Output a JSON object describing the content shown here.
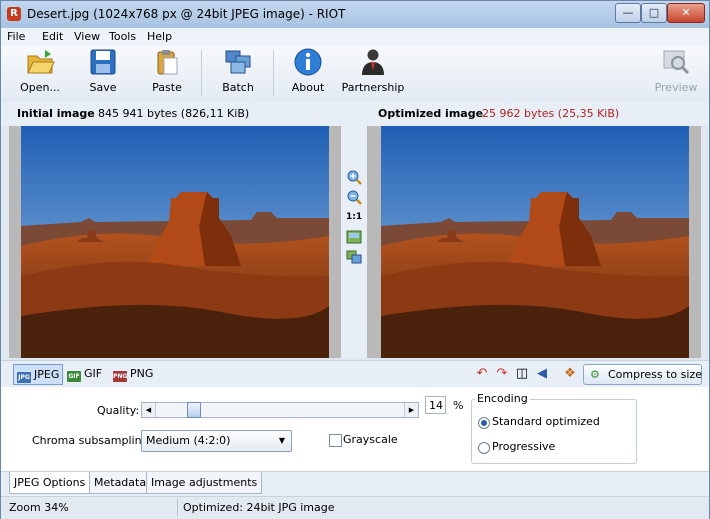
{
  "window": {
    "title": "Desert.jpg (1024x768 px @ 24bit JPEG image) - RIOT"
  },
  "menu": [
    "File",
    "Edit",
    "View",
    "Tools",
    "Help"
  ],
  "toolbar": {
    "open": "Open...",
    "save": "Save",
    "paste": "Paste",
    "batch": "Batch",
    "about": "About",
    "partnership": "Partnership",
    "preview": "Preview"
  },
  "images": {
    "initial_label": "Initial image",
    "initial_size": "845 941 bytes (826,11 KiB)",
    "optimized_label": "Optimized image",
    "optimized_size": "25 962 bytes (25,35 KiB)"
  },
  "zoom_tools": {
    "one_to_one": "1:1"
  },
  "format_tabs": [
    "JPEG",
    "GIF",
    "PNG"
  ],
  "actions": {
    "compress": "Compress to size"
  },
  "options": {
    "quality_label": "Quality:",
    "quality_value": "14",
    "quality_unit": "%",
    "chroma_label": "Chroma subsampling:",
    "chroma_value": "Medium (4:2:0)",
    "grayscale_label": "Grayscale",
    "encoding_title": "Encoding",
    "encoding_standard": "Standard optimized",
    "encoding_progressive": "Progressive"
  },
  "subtabs": [
    "JPEG Options",
    "Metadata",
    "Image adjustments"
  ],
  "status": {
    "zoom": "Zoom 34%",
    "info": "Optimized: 24bit JPG image"
  },
  "colors": {
    "optimized_size": "#b22222",
    "accent": "#2b5aa8"
  }
}
